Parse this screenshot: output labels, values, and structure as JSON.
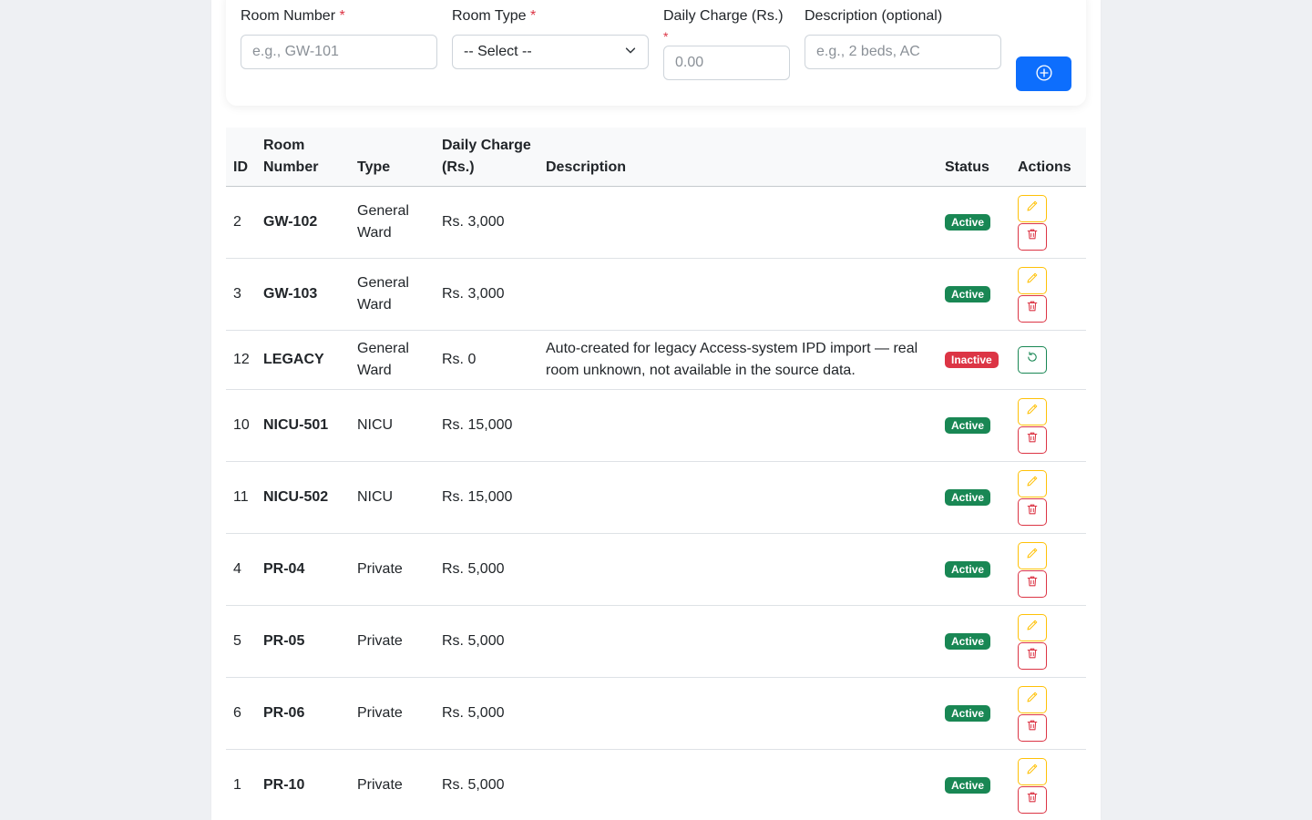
{
  "form": {
    "room_number": {
      "label": "Room Number",
      "required_mark": "*",
      "placeholder": "e.g., GW-101"
    },
    "room_type": {
      "label": "Room Type",
      "required_mark": "*",
      "selected": "-- Select --"
    },
    "daily_charge": {
      "label": "Daily Charge (Rs.)",
      "required_mark": "*",
      "placeholder": "0.00"
    },
    "description": {
      "label": "Description (optional)",
      "placeholder": "e.g., 2 beds, AC"
    },
    "add_button_icon": "plus-circle-icon"
  },
  "table": {
    "headers": {
      "id": "ID",
      "room_number": "Room Number",
      "type": "Type",
      "daily_charge": "Daily Charge (Rs.)",
      "description": "Description",
      "status": "Status",
      "actions": "Actions"
    },
    "rows": [
      {
        "id": "2",
        "room": "GW-102",
        "type": "General Ward",
        "charge": "Rs. 3,000",
        "description": "",
        "status": "Active"
      },
      {
        "id": "3",
        "room": "GW-103",
        "type": "General Ward",
        "charge": "Rs. 3,000",
        "description": "",
        "status": "Active"
      },
      {
        "id": "12",
        "room": "LEGACY",
        "type": "General Ward",
        "charge": "Rs. 0",
        "description": "Auto-created for legacy Access-system IPD import — real room unknown, not available in the source data.",
        "status": "Inactive"
      },
      {
        "id": "10",
        "room": "NICU-501",
        "type": "NICU",
        "charge": "Rs. 15,000",
        "description": "",
        "status": "Active"
      },
      {
        "id": "11",
        "room": "NICU-502",
        "type": "NICU",
        "charge": "Rs. 15,000",
        "description": "",
        "status": "Active"
      },
      {
        "id": "4",
        "room": "PR-04",
        "type": "Private",
        "charge": "Rs. 5,000",
        "description": "",
        "status": "Active"
      },
      {
        "id": "5",
        "room": "PR-05",
        "type": "Private",
        "charge": "Rs. 5,000",
        "description": "",
        "status": "Active"
      },
      {
        "id": "6",
        "room": "PR-06",
        "type": "Private",
        "charge": "Rs. 5,000",
        "description": "",
        "status": "Active"
      },
      {
        "id": "1",
        "room": "PR-10",
        "type": "Private",
        "charge": "Rs. 5,000",
        "description": "",
        "status": "Active"
      }
    ]
  },
  "colors": {
    "primary": "#0d6efd",
    "success": "#198754",
    "danger": "#dc3545",
    "warning": "#ffc107"
  }
}
